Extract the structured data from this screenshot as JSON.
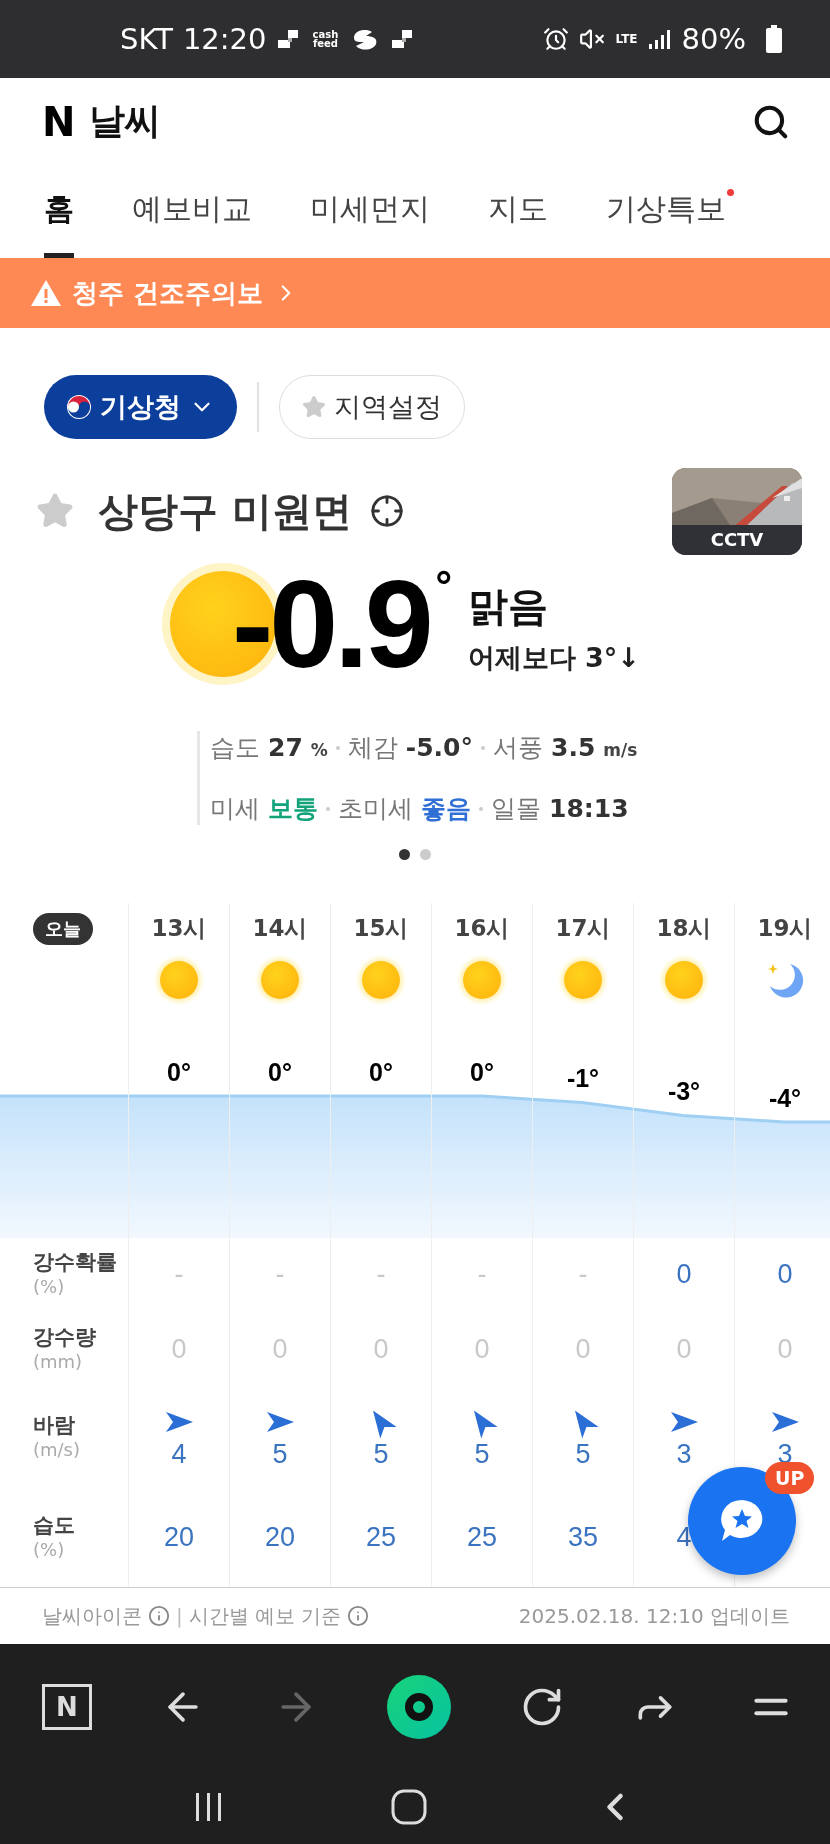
{
  "status_bar": {
    "carrier": "SKT",
    "time": "12:20",
    "app_icon_text": "cash feed",
    "network": "LTE",
    "battery": "80%"
  },
  "header": {
    "logo": "N",
    "title": "날씨"
  },
  "tabs": [
    {
      "label": "홈",
      "selected": true,
      "dot": false
    },
    {
      "label": "예보비교",
      "selected": false,
      "dot": false
    },
    {
      "label": "미세먼지",
      "selected": false,
      "dot": false
    },
    {
      "label": "지도",
      "selected": false,
      "dot": false
    },
    {
      "label": "기상특보",
      "selected": false,
      "dot": true
    }
  ],
  "alert_banner": {
    "text": "청주 건조주의보"
  },
  "source_button": {
    "label": "기상청"
  },
  "region_button": {
    "label": "지역설정"
  },
  "location": {
    "name": "상당구 미원면",
    "favorite": false,
    "cctv_label": "CCTV"
  },
  "current": {
    "temperature": "-0.9",
    "degree": "°",
    "condition": "맑음",
    "comparison": "어제보다 3°↓"
  },
  "details": [
    [
      {
        "label": "습도",
        "value": "27",
        "unit": "%"
      },
      {
        "label": "체감",
        "value": "-5.0°"
      },
      {
        "label": "서풍",
        "value": "3.5",
        "unit": "m/s"
      }
    ],
    [
      {
        "label": "미세",
        "value": "보통",
        "color": "#12a37a"
      },
      {
        "label": "초미세",
        "value": "좋음",
        "color": "#2f6fd6"
      },
      {
        "label": "일몰",
        "value": "18:13"
      }
    ]
  ],
  "pager": [
    {
      "selected": true
    },
    {
      "selected": false
    }
  ],
  "hourly": {
    "today_label": "오늘",
    "row_labels": [
      {
        "name": "강수확률",
        "unit": "(%)"
      },
      {
        "name": "강수량",
        "unit": "(mm)"
      },
      {
        "name": "바람",
        "unit": "(m/s)"
      },
      {
        "name": "습도",
        "unit": "(%)"
      }
    ],
    "hours": [
      {
        "time": "13시",
        "kind": "sun",
        "temp": "0°",
        "precip_chance": "-",
        "precip_chance_muted": true,
        "precip_amount": "0",
        "wind": {
          "kind": "east",
          "speed": "4"
        },
        "humidity": "20"
      },
      {
        "time": "14시",
        "kind": "sun",
        "temp": "0°",
        "precip_chance": "-",
        "precip_chance_muted": true,
        "precip_amount": "0",
        "wind": {
          "kind": "east",
          "speed": "5"
        },
        "humidity": "20"
      },
      {
        "time": "15시",
        "kind": "sun",
        "temp": "0°",
        "precip_chance": "-",
        "precip_chance_muted": true,
        "precip_amount": "0",
        "wind": {
          "kind": "northwest",
          "speed": "5"
        },
        "humidity": "25"
      },
      {
        "time": "16시",
        "kind": "sun",
        "temp": "0°",
        "precip_chance": "-",
        "precip_chance_muted": true,
        "precip_amount": "0",
        "wind": {
          "kind": "northwest",
          "speed": "5"
        },
        "humidity": "25"
      },
      {
        "time": "17시",
        "kind": "sun",
        "temp": "-1°",
        "precip_chance": "-",
        "precip_chance_muted": true,
        "precip_amount": "0",
        "wind": {
          "kind": "northwest",
          "speed": "5"
        },
        "humidity": "35"
      },
      {
        "time": "18시",
        "kind": "sun",
        "temp": "-3°",
        "precip_chance": "0",
        "precip_chance_muted": false,
        "precip_amount": "0",
        "wind": {
          "kind": "east",
          "speed": "3"
        },
        "humidity": "4"
      },
      {
        "time": "19시",
        "kind": "moon",
        "temp": "-4°",
        "precip_chance": "0",
        "precip_chance_muted": false,
        "precip_amount": "0",
        "wind": {
          "kind": "east",
          "speed": "3"
        }
      }
    ]
  },
  "fab": {
    "badge": "UP"
  },
  "footer": {
    "icon_info": "날씨아이콘",
    "separator": "|",
    "forecast_basis": "시간별 예보 기준",
    "updated": "2025.02.18. 12:10 업데이트"
  },
  "browser_nav": {
    "logo": "N",
    "forward_disabled": true
  }
}
